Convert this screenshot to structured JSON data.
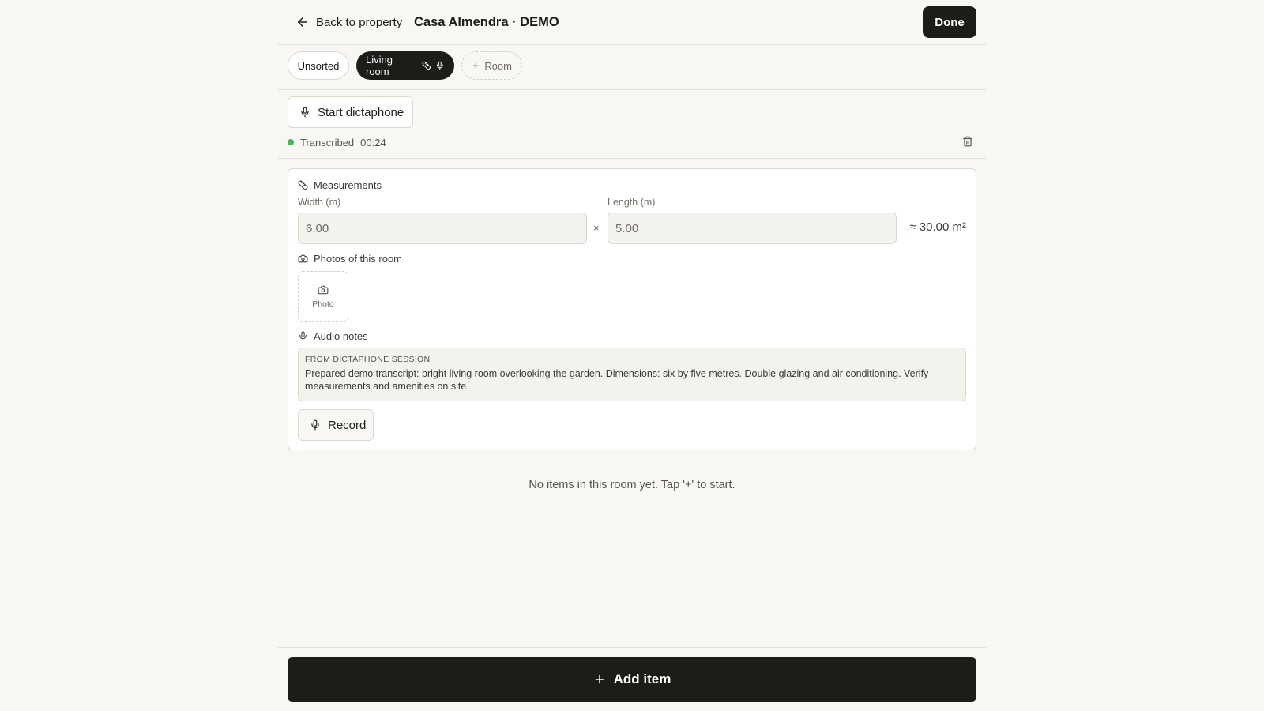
{
  "header": {
    "back_label": "Back to property",
    "title": "Casa Almendra · DEMO",
    "done_label": "Done"
  },
  "tabs": {
    "unsorted": "Unsorted",
    "active": "Living room",
    "add_room": "Room"
  },
  "dictaphone": {
    "start_label": "Start dictaphone",
    "status": "Transcribed",
    "duration": "00:24",
    "status_color": "#46b85a"
  },
  "measurements": {
    "section_label": "Measurements",
    "width_label": "Width (m)",
    "width_value": "6.00",
    "times": "×",
    "length_label": "Length (m)",
    "length_value": "5.00",
    "area": "≈ 30.00 m²"
  },
  "photos": {
    "section_label": "Photos of this room",
    "tile_label": "Photo"
  },
  "audio_notes": {
    "section_label": "Audio notes",
    "source_heading": "FROM DICTAPHONE SESSION",
    "transcript": "Prepared demo transcript: bright living room overlooking the garden. Dimensions: six by five metres. Double glazing and air conditioning. Verify measurements and amenities on site.",
    "record_label": "Record"
  },
  "empty_message": "No items in this room yet. Tap '+' to start.",
  "footer": {
    "add_item_label": "Add item"
  },
  "colors": {
    "primary": "#1e1c19",
    "background": "#f8f7f3",
    "success": "#46b85a"
  },
  "icons": [
    "arrow-left-icon",
    "ruler-icon",
    "mic-icon",
    "plus-icon",
    "trash-icon",
    "camera-icon"
  ]
}
